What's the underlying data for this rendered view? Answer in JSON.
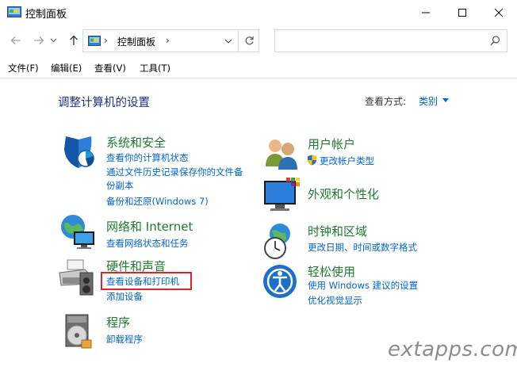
{
  "window": {
    "title": "控制面板",
    "controls": [
      "minimize",
      "maximize",
      "close"
    ]
  },
  "nav": {
    "back_icon": "arrow-left-icon",
    "forward_icon": "arrow-right-icon",
    "recent_icon": "chevron-down-icon",
    "up_icon": "arrow-up-icon",
    "address_separator": "›",
    "address_text": "控制面板",
    "address_trailing_separator": "›",
    "refresh_icon": "refresh-icon",
    "search_placeholder": "",
    "search_icon": "search-icon"
  },
  "menu": {
    "items": [
      "文件(F)",
      "编辑(E)",
      "查看(V)",
      "工具(T)"
    ]
  },
  "content": {
    "title": "调整计算机的设置",
    "view_by_label": "查看方式:",
    "view_by_value": "类别"
  },
  "categories": [
    {
      "heading": "系统和安全",
      "icon": "shield-icon",
      "links": [
        "查看你的计算机状态",
        "通过文件历史记录保存你的文件备",
        "份副本",
        "备份和还原(Windows 7)"
      ]
    },
    {
      "heading": "网络和 Internet",
      "icon": "network-globe-icon",
      "links": [
        "查看网络状态和任务"
      ]
    },
    {
      "heading": "硬件和声音",
      "icon": "printer-speaker-icon",
      "links": [
        "查看设备和打印机",
        "添加设备"
      ]
    },
    {
      "heading": "程序",
      "icon": "programs-disc-icon",
      "links": [
        "卸载程序"
      ]
    },
    {
      "heading": "用户帐户",
      "icon": "users-icon",
      "links": [
        "更改帐户类型"
      ]
    },
    {
      "heading": "外观和个性化",
      "icon": "monitor-palette-icon",
      "links": []
    },
    {
      "heading": "时钟和区域",
      "icon": "clock-globe-icon",
      "links": [
        "更改日期、时间或数字格式"
      ]
    },
    {
      "heading": "轻松使用",
      "icon": "ease-of-access-icon",
      "links": [
        "使用 Windows 建议的设置",
        "优化视觉显示"
      ]
    }
  ],
  "watermark": "extapps.com",
  "colors": {
    "heading_green": "#1f7a30",
    "link_blue": "#0066cc",
    "title_blue": "#1e3287",
    "highlight_red": "#e0232b"
  }
}
